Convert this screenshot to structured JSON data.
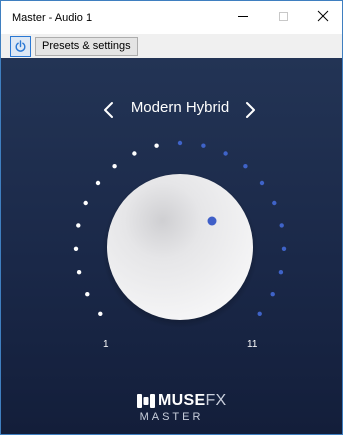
{
  "window": {
    "title": "Master - Audio 1"
  },
  "toolbar": {
    "presets_label": "Presets & settings"
  },
  "plugin": {
    "preset_name": "Modern Hybrid",
    "scale": {
      "min_label": "1",
      "max_label": "11"
    },
    "knob": {
      "tick_count": 21,
      "lit_ticks": 10
    },
    "brand": {
      "name_bold": "MUSE",
      "name_light": "FX",
      "subtitle": "MASTER"
    }
  },
  "colors": {
    "panel_top": "#233455",
    "panel_bottom": "#131e3a",
    "tick_lit": "#ffffff",
    "tick_dim": "#3f63c8",
    "indicator": "#3f5fc8",
    "power_accent": "#2a78d4"
  },
  "icons": {
    "power": "power-icon",
    "prev": "chevron-left-icon",
    "next": "chevron-right-icon",
    "minimize": "minimize-icon",
    "maximize": "maximize-icon",
    "close": "close-icon"
  }
}
